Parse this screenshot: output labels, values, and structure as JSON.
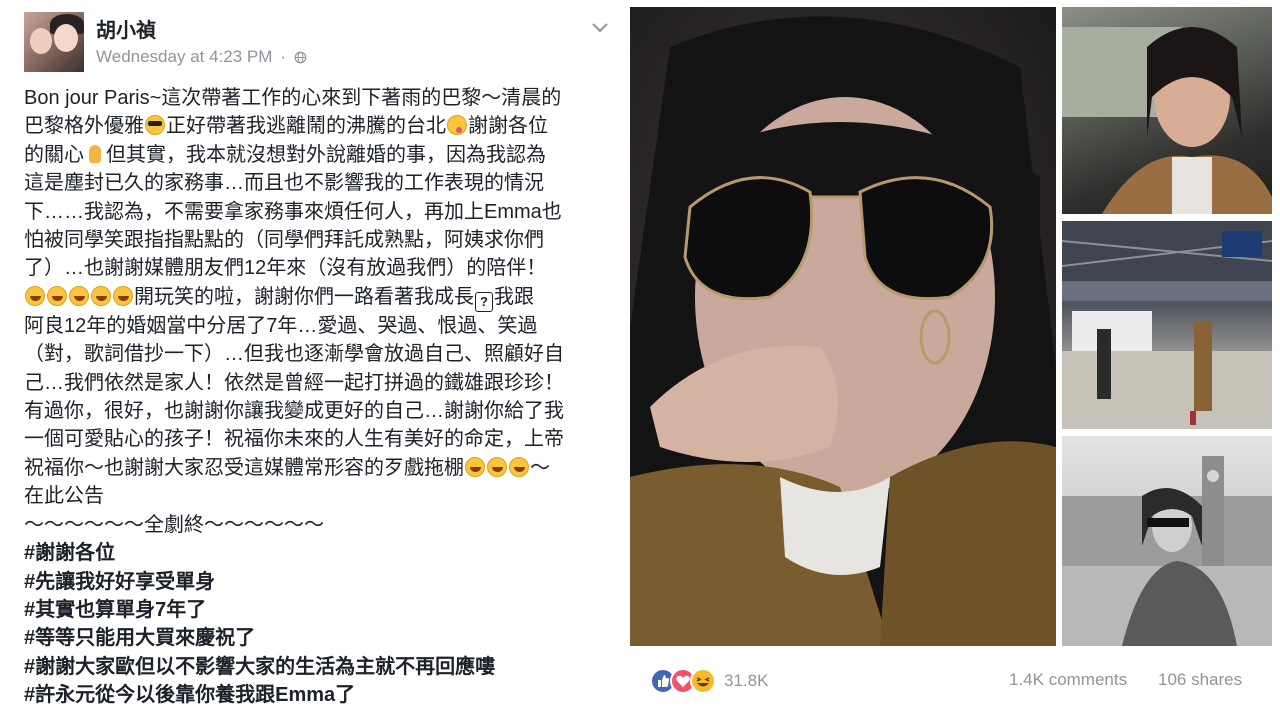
{
  "post": {
    "author": "胡小禎",
    "timestamp": "Wednesday at 4:23 PM",
    "separator": "·",
    "privacy_icon": "globe-icon",
    "menu_icon": "chevron-down-icon",
    "lines": [
      [
        "Bon jour Paris~這次帶著工作的心來到下著雨的巴黎～清晨的"
      ],
      [
        "巴黎格外優雅",
        {
          "emoji": "cool"
        },
        "正好帶著我逃離鬧的沸騰的台北",
        {
          "emoji": "silly"
        },
        "謝謝各位"
      ],
      [
        "的關心",
        {
          "emoji": "pray"
        },
        "但其實，我本就沒想對外說離婚的事，因為我認為"
      ],
      [
        "這是塵封已久的家務事…而且也不影響我的工作表現的情況"
      ],
      [
        "下……我認為，不需要拿家務事來煩任何人，再加上Emma也"
      ],
      [
        "怕被同學笑跟指指點點的（同學們拜託成熟點，阿姨求你們"
      ],
      [
        "了）…也謝謝媒體朋友們12年來（沒有放過我們）的陪伴！"
      ],
      [
        {
          "emoji": "laugh"
        },
        {
          "emoji": "laugh"
        },
        {
          "emoji": "laugh"
        },
        {
          "emoji": "laugh"
        },
        {
          "emoji": "laugh"
        },
        "開玩笑的啦，謝謝你們一路看著我成長",
        {
          "emoji": "box",
          "text": "?"
        },
        "我跟"
      ],
      [
        "阿良12年的婚姻當中分居了7年…愛過、哭過、恨過、笑過"
      ],
      [
        "（對，歌詞借抄一下）…但我也逐漸學會放過自己、照顧好自"
      ],
      [
        "己…我們依然是家人！依然是曾經一起打拼過的鐵雄跟珍珍！"
      ],
      [
        "有過你，很好，也謝謝你讓我變成更好的自己…謝謝你給了我"
      ],
      [
        "一個可愛貼心的孩子！祝福你未來的人生有美好的命定，上帝"
      ],
      [
        "祝福你～也謝謝大家忍受這媒體常形容的歹戲拖棚",
        {
          "emoji": "laugh"
        },
        {
          "emoji": "laugh"
        },
        {
          "emoji": "laugh"
        },
        "～"
      ],
      [
        "在此公告"
      ],
      [
        "～～～～～～全劇終～～～～～～"
      ]
    ],
    "hashtags": [
      "#謝謝各位",
      "#先讓我好好享受單身",
      "#其實也算單身7年了",
      "#等等只能用大買來慶祝了",
      "#謝謝大家歐但以不影響大家的生活為主就不再回應嘍",
      "#許永元從今以後靠你養我跟Emma了"
    ]
  },
  "photos": {
    "main": {
      "label": "selfie-sunglasses-photo"
    },
    "side": [
      {
        "label": "selfie-in-train-photo"
      },
      {
        "label": "train-station-photo"
      },
      {
        "label": "street-clocktower-photo"
      }
    ]
  },
  "footer": {
    "reaction_icons": [
      "like-icon",
      "love-icon",
      "haha-icon"
    ],
    "reaction_count": "31.8K",
    "comments": "1.4K comments",
    "shares": "106 shares"
  },
  "colors": {
    "text": "#1d2129",
    "muted": "#90949c",
    "like_blue": "#4267b2",
    "love_red": "#f25268",
    "haha_yellow": "#f7b928"
  }
}
